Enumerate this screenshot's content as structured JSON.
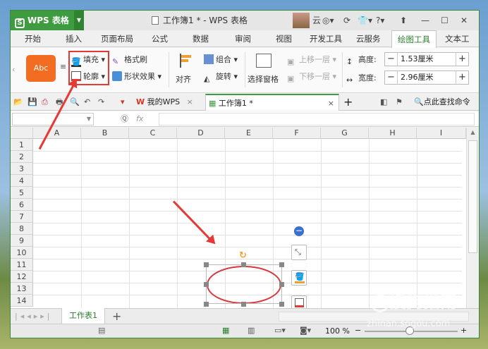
{
  "app": {
    "name": "WPS 表格",
    "window_title": "工作簿1 * - WPS 表格",
    "user_label": "云"
  },
  "ribbon_tabs": [
    "开始",
    "插入",
    "页面布局",
    "公式",
    "数据",
    "审阅",
    "视图",
    "开发工具",
    "云服务",
    "绘图工具",
    "文本工"
  ],
  "active_tab": "绘图工具",
  "ribbon": {
    "style_sample": "Abc",
    "fill": "填充",
    "outline": "轮廓",
    "format_painter": "格式刷",
    "shape_effect": "形状效果",
    "align": "对齐",
    "group": "组合",
    "rotate": "旋转",
    "selection_pane": "选择窗格",
    "bring_forward": "上移一层",
    "send_backward": "下移一层",
    "height_label": "高度:",
    "height_value": "1.53厘米",
    "width_label": "宽度:",
    "width_value": "2.96厘米",
    "minus": "−",
    "plus": "+"
  },
  "doc_tabs": {
    "mywps": "我的WPS",
    "workbook": "工作簿1 *",
    "close": "×",
    "add": "+",
    "search": "点此查找命令"
  },
  "formula_bar": {
    "fx": "fx",
    "name_box": "",
    "formula": ""
  },
  "columns": [
    "A",
    "B",
    "C",
    "D",
    "E",
    "F",
    "G",
    "H",
    "I"
  ],
  "rows": [
    "1",
    "2",
    "3",
    "4",
    "5",
    "6",
    "7",
    "8",
    "9",
    "10",
    "11",
    "12",
    "13",
    "14"
  ],
  "sheet": {
    "name": "工作表1",
    "add": "+"
  },
  "status": {
    "zoom": "100 %",
    "zoom_minus": "−",
    "zoom_plus": "+"
  },
  "watermark": {
    "brand": "搜狗指南",
    "url": "zhinan.sogou.com"
  },
  "colors": {
    "accent": "#3f9b3f",
    "highlight": "#e53935",
    "shape_outline": "#d9363e"
  }
}
